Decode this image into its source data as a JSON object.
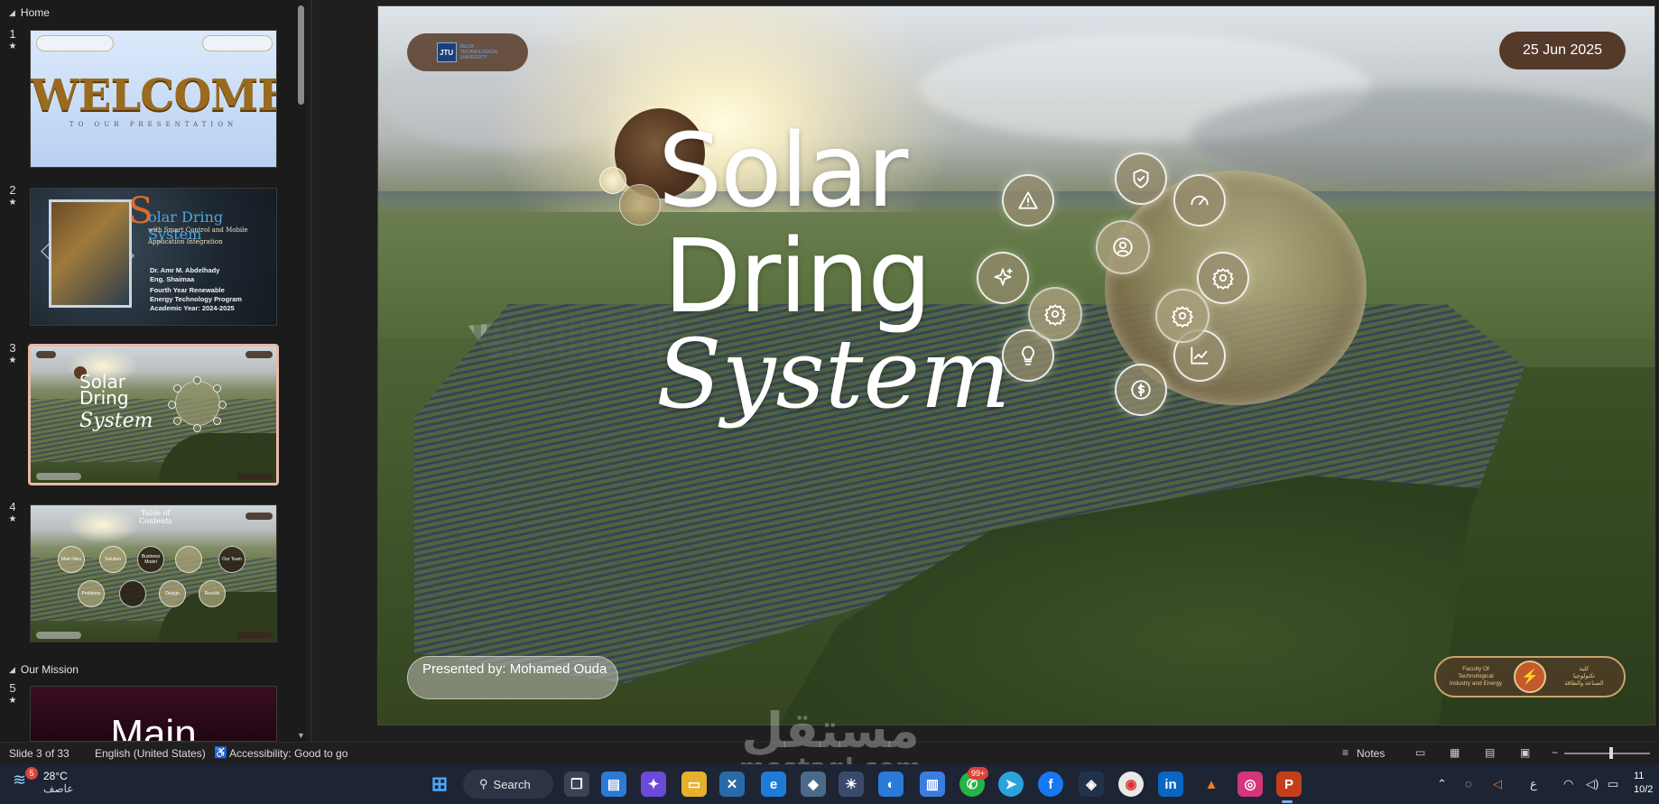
{
  "thumbnails_pane": {
    "sections": [
      {
        "label": "Home"
      },
      {
        "label": "Our Mission"
      }
    ],
    "slides": [
      {
        "number": "1",
        "star": "★",
        "main_text": "WELCOME",
        "sub_text": "TO OUR PRESENTATION"
      },
      {
        "number": "2",
        "star": "★",
        "s_letter": "S",
        "title": "olar Dring System",
        "line1": "with Smart Control and Mobile",
        "line2": "Application Integration",
        "info": [
          "Dr. Amr M. Abdelhady",
          "Eng. Shaimaa",
          "Fourth Year Renewable",
          "Energy Technology Program",
          "Academic Year: 2024-2025"
        ]
      },
      {
        "number": "3",
        "star": "★",
        "title_lines": [
          "Solar",
          "Dring"
        ],
        "title_italic": "System"
      },
      {
        "number": "4",
        "star": "★",
        "toc": [
          "Table of",
          "Contents"
        ],
        "bubbles": [
          "Main Idea",
          "Solution",
          "Business Model",
          "",
          "Our Team",
          "Problems",
          "",
          "Design",
          "Results"
        ]
      },
      {
        "number": "5",
        "star": "★",
        "main_text": "Main"
      }
    ]
  },
  "slide": {
    "logo_text": "JTU",
    "logo_caption": [
      "DELTA",
      "TECHNOLOGICAL",
      "UNIVERSITY"
    ],
    "date": "25 Jun 2025",
    "title_line1": "Solar",
    "title_line2": "Dring",
    "title_line3": "System",
    "presenter": "Presented by: Mohamed Ouda",
    "faculty_en": [
      "Faculty Of",
      "Technological",
      "Industry and Energy"
    ],
    "faculty_ar": [
      "كلية",
      "تكنولوجيا",
      "الصناعة والطاقة"
    ],
    "icons": [
      "shield-check",
      "gauge",
      "settings",
      "chart-line",
      "dollar",
      "lightbulb",
      "sparkles",
      "warning",
      "user-target",
      "settings",
      "settings"
    ]
  },
  "statusbar": {
    "slide_counter": "Slide 3 of 33",
    "language": "English (United States)",
    "accessibility": "Accessibility: Good to go",
    "notes": "Notes"
  },
  "watermark": {
    "arabic": "مستقل",
    "latin": "mostaql.com"
  },
  "taskbar": {
    "weather_badge": "5",
    "temperature": "28°C",
    "condition": "عاصف",
    "search": "Search",
    "whatsapp_badge": "99+",
    "lang_indicator": "ع",
    "clock_time": "11",
    "clock_date": "10/2"
  }
}
